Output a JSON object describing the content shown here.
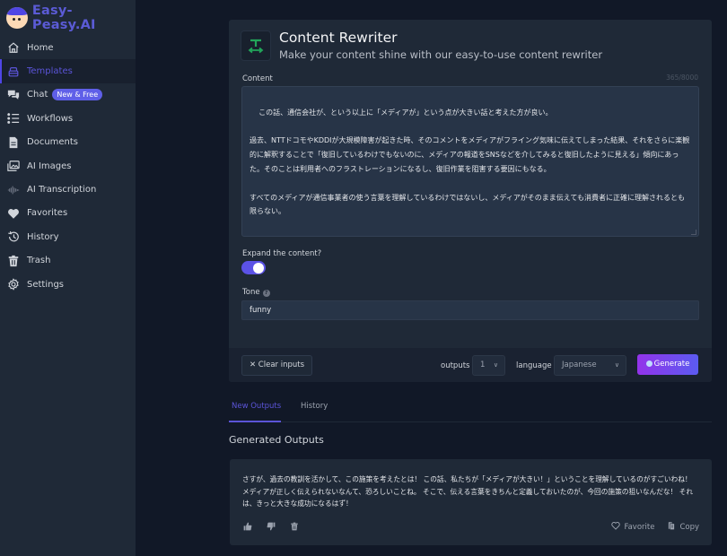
{
  "brand": {
    "name": "Easy-Peasy.AI"
  },
  "sidebar": {
    "items": [
      {
        "label": "Home",
        "icon": "home-icon"
      },
      {
        "label": "Templates",
        "icon": "templates-icon",
        "active": true
      },
      {
        "label": "Chat",
        "icon": "chat-icon",
        "badge": "New & Free"
      },
      {
        "label": "Workflows",
        "icon": "workflows-icon"
      },
      {
        "label": "Documents",
        "icon": "document-icon"
      },
      {
        "label": "AI Images",
        "icon": "images-icon"
      },
      {
        "label": "AI Transcription",
        "icon": "waveform-icon"
      },
      {
        "label": "Favorites",
        "icon": "heart-icon"
      },
      {
        "label": "History",
        "icon": "history-icon"
      },
      {
        "label": "Trash",
        "icon": "trash-icon"
      },
      {
        "label": "Settings",
        "icon": "gear-icon"
      }
    ]
  },
  "tool": {
    "title": "Content Rewriter",
    "subtitle": "Make your content shine with our easy-to-use content rewriter",
    "icon": "text-width-icon",
    "accent": "#22a55a"
  },
  "form": {
    "content_label": "Content",
    "content_counter": "365/8000",
    "content_value": "この話、通信会社が、という以上に「メディアが」という点が大きい話と考えた方が良い。\n\n過去、NTTドコモやKDDIが大規模障害が起きた時、そのコメントをメディアがフライング気味に伝えてしまった結果、それをさらに楽観的に解釈することで「復旧しているわけでもないのに、メディアの報道をSNSなどを介してみると復旧したように見える」傾向にあった。そのことは利用者へのフラストレーションになるし、復旧作業を阻害する要因にもなる。\n\nすべてのメディアが通信事業者の使う言葉を理解しているわけではないし、メディアがそのまま伝えても消費者に正確に理解されるとも限らない。\n\nそこで、相互の認識のズレが出にくくなる言葉をちゃんと「外向きのメッセージ用に定義しておく」というのが、今回の施策の狙いである。\n\nこれもまた過去の教訓に習った施策である。",
    "expand_label": "Expand the content?",
    "expand_on": true,
    "tone_label": "Tone",
    "tone_value": "funny"
  },
  "footer": {
    "clear_label": "✕ Clear inputs",
    "outputs_label": "outputs",
    "outputs_value": "1",
    "language_label": "language",
    "language_value": "Japanese",
    "generate_label": "Generate"
  },
  "tabs": [
    {
      "label": "New Outputs",
      "active": true
    },
    {
      "label": "History"
    }
  ],
  "outputs": {
    "section_title": "Generated Outputs",
    "items": [
      {
        "text": "さすが、過去の教訓を活かして、この施策を考えたとは！ この話、私たちが「メディアが大きい！」ということを理解しているのがすごいわね！ メディアが正しく伝えられないなんて、恐ろしいことね。 そこで、伝える言葉をきちんと定義しておいたのが、今回の施策の狙いなんだな！ それは、きっと大きな成功になるはず！",
        "favorite_label": "Favorite",
        "copy_label": "Copy"
      }
    ]
  },
  "colors": {
    "primary": "#5b54d8",
    "background": "#111827",
    "panel": "#1f2937"
  }
}
